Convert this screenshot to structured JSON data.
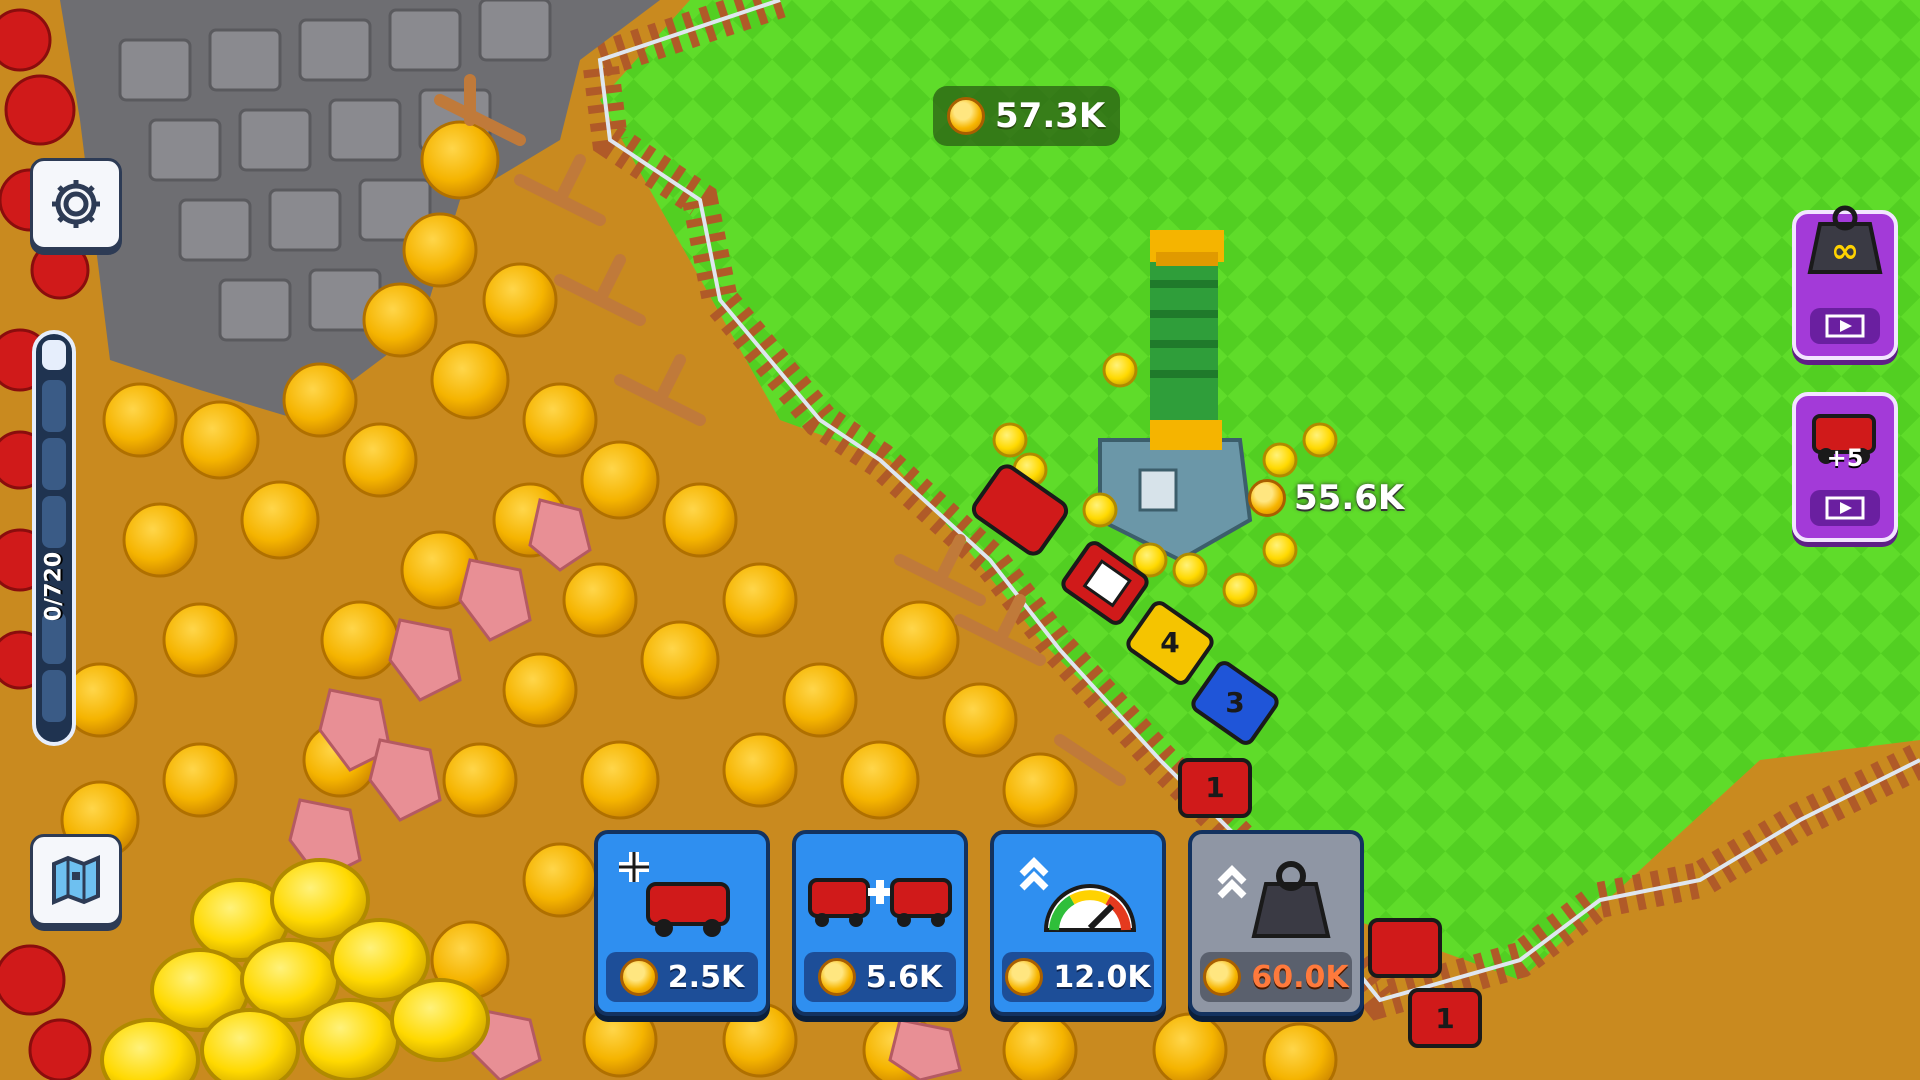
{
  "hud": {
    "coin_balance": "57.3K",
    "capacity_label": "0/720",
    "capacity_fill": 0.0
  },
  "popup": {
    "floating_value": "55.6K"
  },
  "side_buttons": {
    "settings_icon": "gear-icon",
    "map_icon": "map-icon"
  },
  "right_panel": {
    "infinite_weight_icon": "infinity-weight-icon",
    "add_wagons_label": "+5",
    "ad_icon": "video-ad-icon"
  },
  "shop": [
    {
      "name": "add-wagon",
      "price": "2.5K",
      "icon": "add-wagon-icon",
      "locked": false
    },
    {
      "name": "merge-wagons",
      "price": "5.6K",
      "icon": "merge-wagons-icon",
      "locked": false
    },
    {
      "name": "speed-upgrade",
      "price": "12.0K",
      "icon": "speedometer-icon",
      "locked": false
    },
    {
      "name": "capacity-upgrade",
      "price": "60.0K",
      "icon": "weight-upgrade-icon",
      "locked": true
    }
  ],
  "wagon_numbers": [
    "4",
    "3",
    "1",
    "1"
  ],
  "colors": {
    "grass": "#5fdc2a",
    "grass_dark": "#4cc21c",
    "dirt": "#c98a1f",
    "card_blue": "#2f8ff0",
    "card_locked": "#8f96a4",
    "card_purple": "#a33ad8",
    "price_red": "#ff7a3c"
  }
}
